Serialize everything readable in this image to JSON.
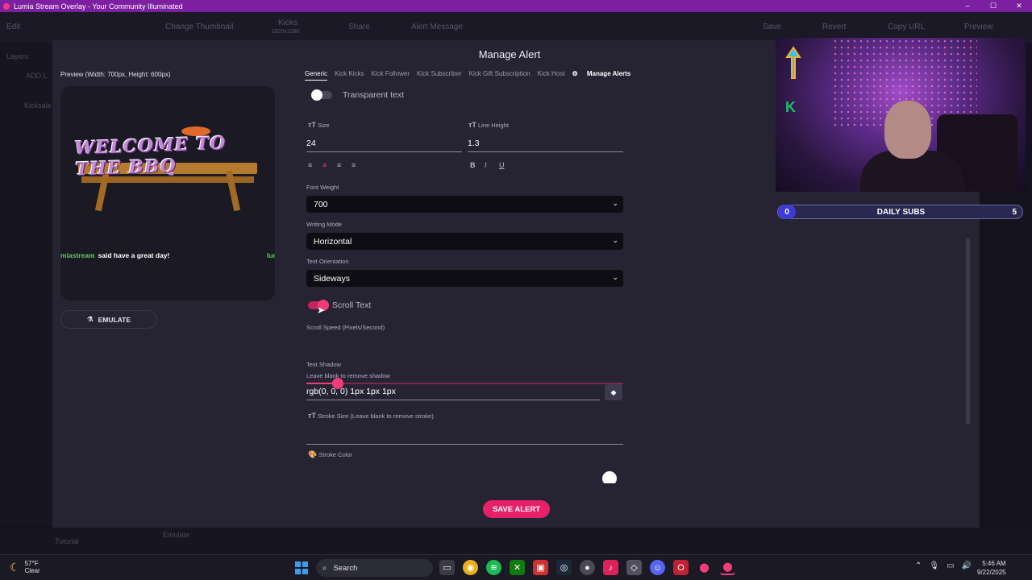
{
  "window": {
    "title": "Lumia Stream Overlay - Your Community Illuminated",
    "controls": [
      "–",
      "☐",
      "✕"
    ]
  },
  "background": {
    "toolbar": [
      "Edit",
      "Change Thumbnail",
      "Kicks",
      "Share",
      "Alert Message",
      "Save",
      "Revert",
      "Copy URL",
      "Preview"
    ],
    "kicks_sub": "1920x1080",
    "layers_label": "Layers",
    "add_layer": "ADD L",
    "layer_item": "Kicksale",
    "tutorial": "Tutorial",
    "emulate": "Emulate"
  },
  "modal": {
    "title": "Manage Alert",
    "preview_label": "Preview (Width: 700px, Height: 600px)",
    "preview": {
      "banner_text": "WELCOME TO THE BBQ",
      "chat_user": "miastream",
      "chat_message": "said have a great day!",
      "chat_user_next": "lur"
    },
    "emulate_label": "EMULATE",
    "tabs": [
      "Generic",
      "Kick Kicks",
      "Kick Follower",
      "Kick Subscriber",
      "Kick Gift Subscription",
      "Kick Host"
    ],
    "manage_alerts_label": "Manage Alerts",
    "form": {
      "transparent_text_label": "Transparent text",
      "transparent_text_on": false,
      "size_label": "Size",
      "size_value": "24",
      "line_height_label": "Line Height",
      "line_height_value": "1.3",
      "align_icons": [
        "≡",
        "≡",
        "≡",
        "≡"
      ],
      "style_icons": [
        "B",
        "I",
        "U"
      ],
      "font_weight_label": "Font Weight",
      "font_weight_value": "700",
      "writing_mode_label": "Writing Mode",
      "writing_mode_value": "Horizontal",
      "text_orientation_label": "Text Orientation",
      "text_orientation_value": "Sideways",
      "scroll_text_label": "Scroll Text",
      "scroll_text_on": true,
      "scroll_speed_label": "Scroll Speed (Pixels/Second)",
      "scroll_speed_fraction": 0.1,
      "text_shadow_label": "Text Shadow",
      "text_shadow_hint": "Leave blank to remove shadow",
      "text_shadow_value": "rgb(0, 0, 0) 1px 1px 1px",
      "stroke_size_label": "Stroke Size (Leave blank to remove stroke)",
      "stroke_size_value": "",
      "stroke_color_label": "Stroke Color",
      "stroke_color_value": "#ffffff"
    },
    "save_label": "SAVE ALERT"
  },
  "overlay_widget": {
    "daily_subs_label": "DAILY SUBS",
    "count_current": "0",
    "count_goal": "5"
  },
  "taskbar": {
    "temperature": "57°F",
    "condition": "Clear",
    "search_label": "Search",
    "time": "5:46 AM",
    "date": "9/22/2025"
  },
  "colors": {
    "accent": "#e8206a",
    "titlebar": "#7c1fa0",
    "modal_bg": "#262333"
  }
}
